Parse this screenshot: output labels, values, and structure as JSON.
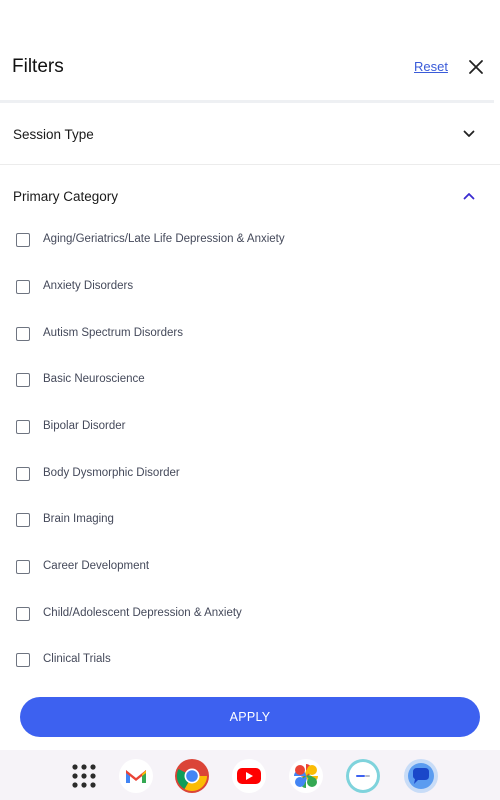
{
  "header": {
    "title": "Filters",
    "reset_label": "Reset",
    "close_icon": "close-icon"
  },
  "sections": {
    "session_type": {
      "label": "Session Type",
      "expanded": false
    },
    "primary_category": {
      "label": "Primary Category",
      "expanded": true
    }
  },
  "categories": [
    {
      "label": "Aging/Geriatrics/Late Life Depression & Anxiety",
      "checked": false
    },
    {
      "label": "Anxiety Disorders",
      "checked": false
    },
    {
      "label": "Autism Spectrum Disorders",
      "checked": false
    },
    {
      "label": "Basic Neuroscience",
      "checked": false
    },
    {
      "label": "Bipolar Disorder",
      "checked": false
    },
    {
      "label": "Body Dysmorphic Disorder",
      "checked": false
    },
    {
      "label": "Brain Imaging",
      "checked": false
    },
    {
      "label": "Career Development",
      "checked": false
    },
    {
      "label": "Child/Adolescent Depression & Anxiety",
      "checked": false
    },
    {
      "label": "Clinical Trials",
      "checked": false
    }
  ],
  "apply_label": "APPLY",
  "colors": {
    "accent": "#3d61f0",
    "link": "#3a5bd9",
    "chevron_expanded": "#3a2bd0"
  },
  "dock": {
    "apps": [
      "app-drawer-icon",
      "gmail-icon",
      "chrome-icon",
      "youtube-icon",
      "photos-icon",
      "app-icon",
      "messages-icon"
    ]
  }
}
